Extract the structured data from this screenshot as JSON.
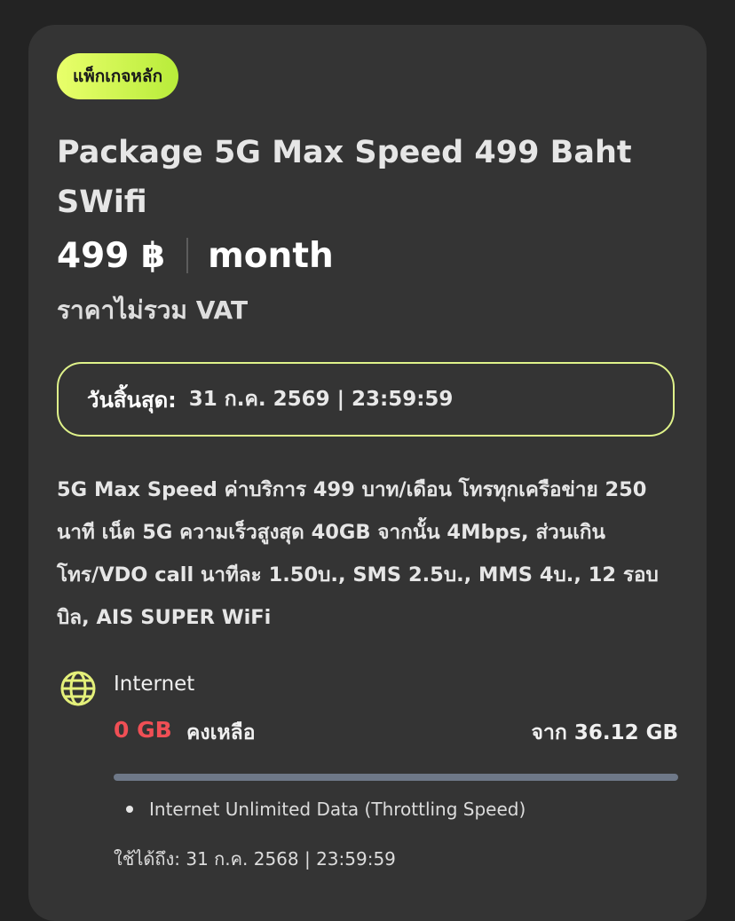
{
  "package": {
    "badge": "แพ็กเกจหลัก",
    "title": "Package 5G Max Speed 499 Baht SWifi",
    "price": "499 ฿",
    "period": "month",
    "vat_note": "ราคาไม่รวม VAT",
    "expiry_label": "วันสิ้นสุด:",
    "expiry_value": "31 ก.ค. 2569 | 23:59:59",
    "description": "5G Max Speed ค่าบริการ 499 บาท/เดือน โทรทุกเครือข่าย 250 นาที เน็ต 5G ความเร็วสูงสุด 40GB จากนั้น 4Mbps, ส่วนเกินโทร/VDO call นาทีละ 1.50บ., SMS 2.5บ., MMS 4บ., 12 รอบบิล, AIS SUPER WiFi"
  },
  "internet": {
    "icon": "globe-icon",
    "label": "Internet",
    "remaining": "0 GB",
    "remaining_label": "คงเหลือ",
    "total": "จาก 36.12 GB",
    "used_fraction": 0,
    "bullet": "Internet Unlimited Data (Throttling Speed)",
    "valid_until": "ใช้ได้ถึง: 31 ก.ค. 2568 | 23:59:59"
  },
  "colors": {
    "badge_gradient_start": "#e9ff6b",
    "badge_gradient_end": "#b8ec3a",
    "accent_border": "#dff28a",
    "remaining_red": "#f04f55",
    "card_bg": "#343434",
    "page_bg": "#232323",
    "bar_track": "#6e7888"
  }
}
